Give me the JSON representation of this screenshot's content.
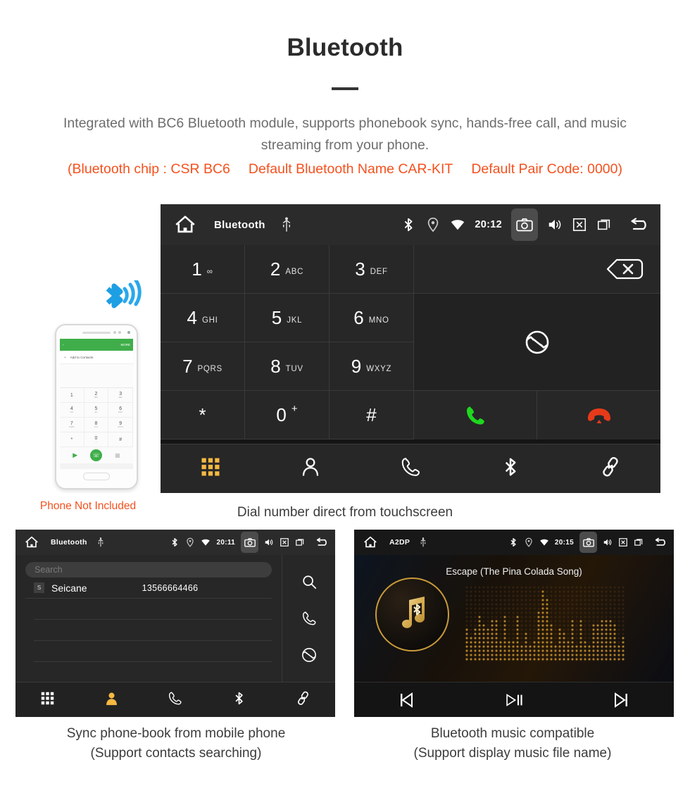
{
  "header": {
    "title": "Bluetooth",
    "description": "Integrated with BC6 Bluetooth module, supports phonebook sync, hands-free call, and music streaming from your phone.",
    "spec_chip": "(Bluetooth chip : CSR BC6",
    "spec_name": "Default Bluetooth Name CAR-KIT",
    "spec_pair": "Default Pair Code: 0000)"
  },
  "colors": {
    "accent_orange": "#f4511e",
    "nav_active": "#f5b942",
    "call_green": "#1ed81e",
    "hangup_red": "#e63a1a",
    "screen_bg": "#272727",
    "statusbar_bg": "#2b2b2b",
    "bluetooth_blue": "#1e9fe3",
    "gold": "#c99a3a"
  },
  "dialer_screen": {
    "statusbar": {
      "home_icon": "home-icon",
      "title": "Bluetooth",
      "usb_icon": "usb-icon",
      "bluetooth_icon": "bluetooth-icon",
      "location_icon": "location-pin-icon",
      "wifi_icon": "wifi-icon",
      "clock": "20:12",
      "camera_icon": "camera-icon",
      "volume_icon": "volume-icon",
      "close_icon": "close-box-icon",
      "recents_icon": "recent-apps-icon",
      "back_icon": "back-arrow-icon"
    },
    "keys": [
      {
        "digit": "1",
        "letters": "∞",
        "name": "key-1"
      },
      {
        "digit": "2",
        "letters": "ABC",
        "name": "key-2"
      },
      {
        "digit": "3",
        "letters": "DEF",
        "name": "key-3"
      },
      {
        "digit": "4",
        "letters": "GHI",
        "name": "key-4"
      },
      {
        "digit": "5",
        "letters": "JKL",
        "name": "key-5"
      },
      {
        "digit": "6",
        "letters": "MNO",
        "name": "key-6"
      },
      {
        "digit": "7",
        "letters": "PQRS",
        "name": "key-7"
      },
      {
        "digit": "8",
        "letters": "TUV",
        "name": "key-8"
      },
      {
        "digit": "9",
        "letters": "WXYZ",
        "name": "key-9"
      },
      {
        "digit": "*",
        "letters": "",
        "name": "key-star"
      },
      {
        "digit": "0",
        "letters": "+",
        "name": "key-0"
      },
      {
        "digit": "#",
        "letters": "",
        "name": "key-hash"
      }
    ],
    "number_display": "",
    "backspace_icon": "backspace-icon",
    "sync_icon": "sync-transfer-icon",
    "call_icon": "call-icon",
    "hangup_icon": "hangup-icon",
    "bottom_nav": [
      {
        "icon": "dialpad-icon",
        "active": true
      },
      {
        "icon": "contacts-icon",
        "active": false
      },
      {
        "icon": "call-log-icon",
        "active": false
      },
      {
        "icon": "bluetooth-icon",
        "active": false
      },
      {
        "icon": "link-icon",
        "active": false
      }
    ],
    "caption": "Dial number direct from touchscreen"
  },
  "phone_mockup": {
    "bluetooth_wave_icon": "bluetooth-signal-icon",
    "appbar_back": "‹",
    "appbar_more": "MORE",
    "add_contacts_label": "Add to Contacts",
    "keys": [
      {
        "digit": "1",
        "sub": ""
      },
      {
        "digit": "2",
        "sub": "ABC"
      },
      {
        "digit": "3",
        "sub": "DEF"
      },
      {
        "digit": "4",
        "sub": "GHI"
      },
      {
        "digit": "5",
        "sub": "JKL"
      },
      {
        "digit": "6",
        "sub": "MNO"
      },
      {
        "digit": "7",
        "sub": "PQRS"
      },
      {
        "digit": "8",
        "sub": "TUV"
      },
      {
        "digit": "9",
        "sub": "WXYZ"
      },
      {
        "digit": "*",
        "sub": ""
      },
      {
        "digit": "0",
        "sub": "+"
      },
      {
        "digit": "#",
        "sub": ""
      }
    ],
    "note": "Phone Not Included"
  },
  "phonebook_screen": {
    "statusbar": {
      "title": "Bluetooth",
      "clock": "20:11"
    },
    "search_placeholder": "Search",
    "contacts": [
      {
        "initial": "S",
        "name": "Seicane",
        "number": "13566664466"
      }
    ],
    "rail": [
      {
        "icon": "search-icon"
      },
      {
        "icon": "call-icon"
      },
      {
        "icon": "sync-icon"
      }
    ],
    "bottom_nav": [
      {
        "icon": "dialpad-icon",
        "active": false
      },
      {
        "icon": "contacts-icon",
        "active": true
      },
      {
        "icon": "call-log-icon",
        "active": false
      },
      {
        "icon": "bluetooth-icon",
        "active": false
      },
      {
        "icon": "link-icon",
        "active": false
      }
    ],
    "caption_line1": "Sync phone-book from mobile phone",
    "caption_line2": "(Support contacts searching)"
  },
  "music_screen": {
    "statusbar": {
      "title": "A2DP",
      "clock": "20:15"
    },
    "track_title": "Escape (The Pina Colada Song)",
    "album_art_icon": "music-note-bluetooth-icon",
    "equalizer_icon": "equalizer-dots",
    "controls": [
      {
        "icon": "previous-track-icon"
      },
      {
        "icon": "play-pause-icon"
      },
      {
        "icon": "next-track-icon"
      }
    ],
    "caption_line1": "Bluetooth music compatible",
    "caption_line2": "(Support display music file name)"
  }
}
